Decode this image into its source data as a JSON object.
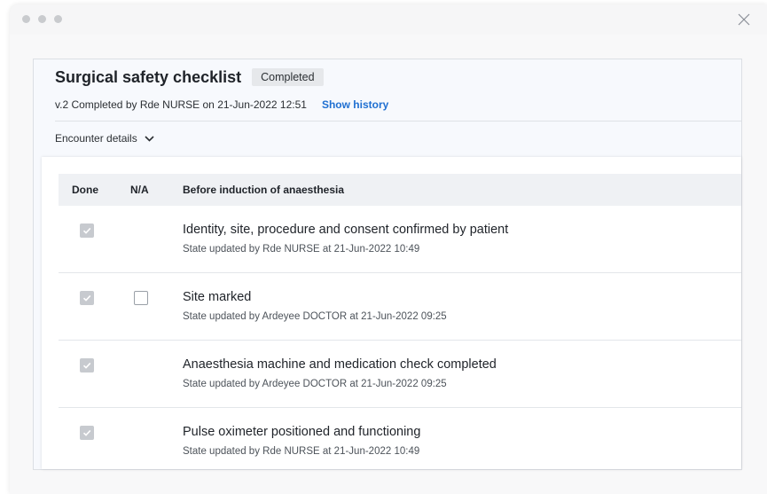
{
  "window": {
    "close_icon": "close-icon"
  },
  "header": {
    "title": "Surgical safety checklist",
    "status": "Completed",
    "meta": "v.2 Completed by Rde NURSE on 21-Jun-2022 12:51",
    "history_link": "Show history"
  },
  "encounter": {
    "label": "Encounter details",
    "icon": "chevron-down-icon"
  },
  "table": {
    "columns": {
      "done": "Done",
      "na": "N/A",
      "section": "Before induction of anaesthesia"
    },
    "rows": [
      {
        "title": "Identity, site, procedure and consent confirmed by patient",
        "subtitle": "State updated by Rde NURSE at 21-Jun-2022 10:49",
        "done": true,
        "na": null
      },
      {
        "title": "Site marked",
        "subtitle": "State updated by Ardeyee DOCTOR at 21-Jun-2022 09:25",
        "done": true,
        "na": false
      },
      {
        "title": "Anaesthesia machine and medication check completed",
        "subtitle": "State updated by Ardeyee DOCTOR at 21-Jun-2022 09:25",
        "done": true,
        "na": null
      },
      {
        "title": "Pulse oximeter positioned and functioning",
        "subtitle": "State updated by Rde NURSE at 21-Jun-2022 10:49",
        "done": true,
        "na": null
      }
    ]
  },
  "colors": {
    "link": "#1f6fd1",
    "checkbox_checked": "#c7cacf",
    "header_bg": "#eff1f4"
  }
}
